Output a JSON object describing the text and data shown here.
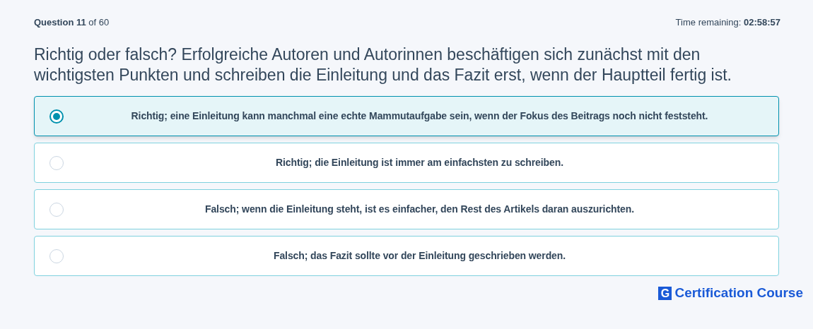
{
  "header": {
    "question_label": "Question",
    "question_number": "11",
    "of_text": "of 60",
    "time_label": "Time remaining:",
    "time_value": "02:58:57"
  },
  "question": "Richtig oder falsch? Erfolgreiche Autoren und Autorinnen beschäftigen sich zunächst mit den wichtigsten Punkten und schreiben die Einleitung und das Fazit erst, wenn der Hauptteil fertig ist.",
  "options": [
    {
      "label": "Richtig; eine Einleitung kann manchmal eine echte Mammutaufgabe sein, wenn der Fokus des Beitrags noch nicht feststeht.",
      "selected": true
    },
    {
      "label": "Richtig; die Einleitung ist immer am einfachsten zu schreiben.",
      "selected": false
    },
    {
      "label": "Falsch; wenn die Einleitung steht, ist es einfacher, den Rest des Artikels daran auszurichten.",
      "selected": false
    },
    {
      "label": "Falsch; das Fazit sollte vor der Einleitung geschrieben werden.",
      "selected": false
    }
  ],
  "brand": {
    "logo_letter": "G",
    "name": "Certification Course"
  }
}
